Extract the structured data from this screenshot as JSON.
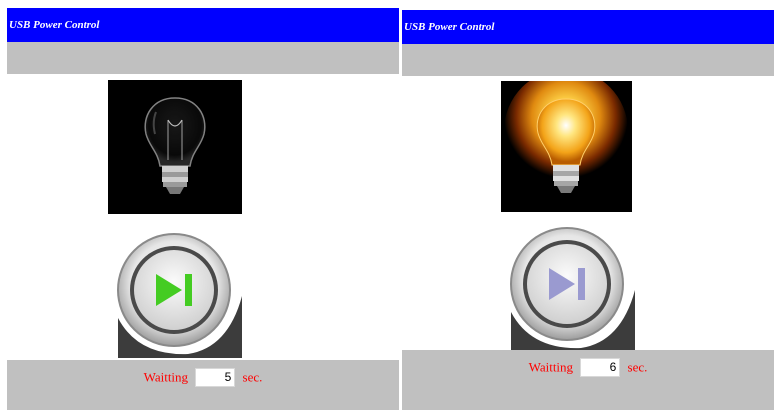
{
  "panels": [
    {
      "title": "USB Power Control",
      "bulb_state": "off",
      "button_state": "play-enabled",
      "button_icon_color": "#44cc22",
      "wait_label": "Waitting",
      "wait_value": "5",
      "wait_unit": "sec."
    },
    {
      "title": "USB Power Control",
      "bulb_state": "on",
      "button_state": "play-disabled",
      "button_icon_color": "#9a9ad0",
      "wait_label": "Waitting",
      "wait_value": "6",
      "wait_unit": "sec."
    }
  ],
  "colors": {
    "titlebar": "#0000ff",
    "gray_bar": "#c0c0c0",
    "wait_text": "#ff0000"
  }
}
